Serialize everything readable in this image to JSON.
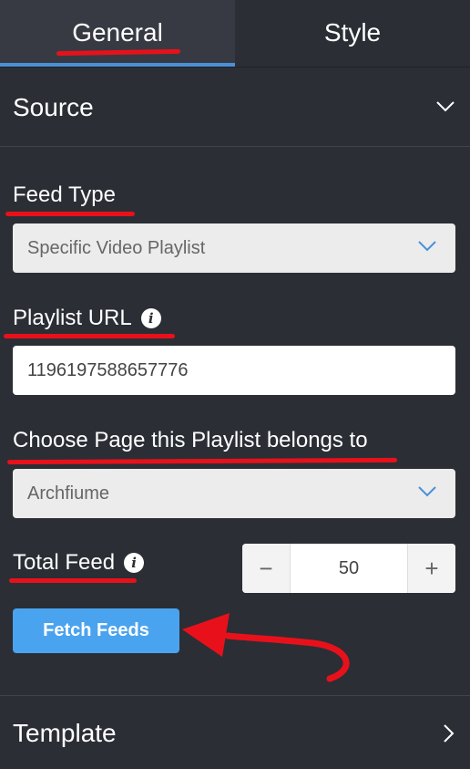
{
  "tabs": [
    {
      "label": "General",
      "active": true
    },
    {
      "label": "Style",
      "active": false
    }
  ],
  "source_section": {
    "title": "Source",
    "feed_type": {
      "label": "Feed Type",
      "value": "Specific Video Playlist"
    },
    "playlist_url": {
      "label": "Playlist URL",
      "value": "1196197588657776"
    },
    "page": {
      "label": "Choose Page this Playlist belongs to",
      "value": "Archfiume"
    },
    "total_feed": {
      "label": "Total Feed",
      "value": "50",
      "minus": "−",
      "plus": "+"
    },
    "fetch_button": "Fetch Feeds"
  },
  "template_section": {
    "title": "Template"
  },
  "info_glyph": "i",
  "colors": {
    "panel_bg": "#2b2e35",
    "active_tab_bg": "#373a43",
    "accent_blue": "#4aa3ef",
    "annotation_red": "#e8111b"
  }
}
